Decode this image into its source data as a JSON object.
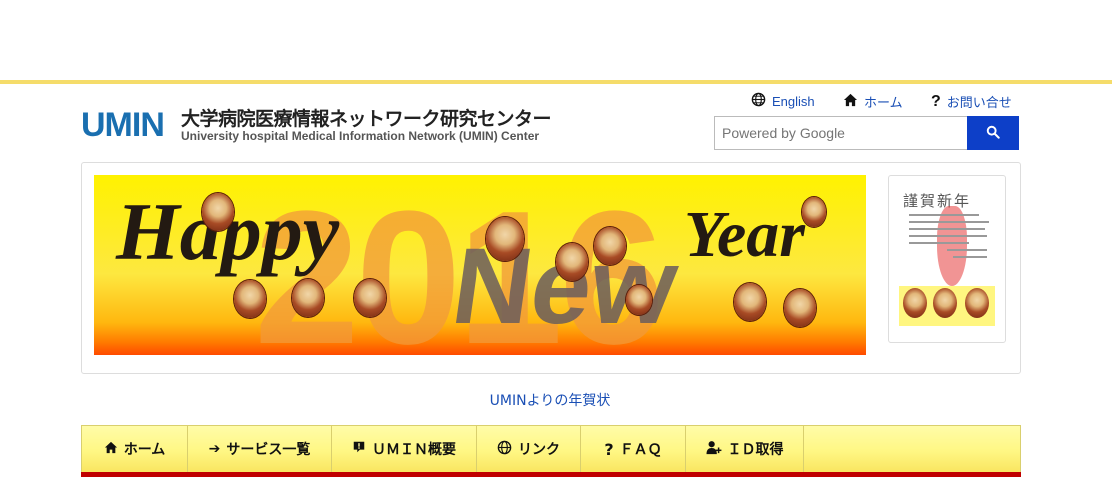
{
  "header": {
    "logo": "UMIN",
    "title": "大学病院医療情報ネットワーク研究センター",
    "subtitle": "University hospital Medical Information Network (UMIN) Center"
  },
  "toplinks": {
    "english": "English",
    "home": "ホーム",
    "contact": "お問い合せ"
  },
  "search": {
    "placeholder": "Powered by Google"
  },
  "banner": {
    "year": "2016",
    "happy": "Happy",
    "new": "New",
    "year_word": "Year"
  },
  "card": {
    "greeting": "謹賀新年"
  },
  "caption": "UMINよりの年賀状",
  "nav": {
    "items": [
      {
        "label": "ホーム",
        "icon": "home-icon"
      },
      {
        "label": "サービス一覧",
        "icon": "arrow-right-icon"
      },
      {
        "label": "ＵＭＩＮ概要",
        "icon": "info-icon"
      },
      {
        "label": "リンク",
        "icon": "globe-icon"
      },
      {
        "label": "ＦＡＱ",
        "icon": "question-icon"
      },
      {
        "label": "ＩＤ取得",
        "icon": "user-add-icon"
      }
    ]
  },
  "colors": {
    "accent_blue": "#1a4fb5",
    "search_button": "#0d3fc8",
    "nav_red": "#c00000",
    "topbar_yellow": "#f5dc6a"
  }
}
